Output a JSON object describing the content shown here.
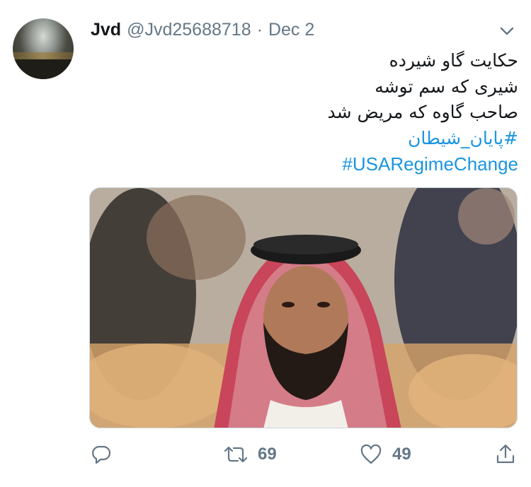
{
  "tweet": {
    "author_name": "Jvd",
    "author_handle": "@Jvd25688718",
    "separator": "·",
    "date": "Dec 2",
    "lines": [
      "حکایت گاو شیرده",
      "شیری که سم توشه",
      "صاحب گاوه که مریض شد"
    ],
    "hashtags": [
      "#پایان_شیطان",
      "#USARegimeChange"
    ]
  },
  "actions": {
    "reply_count": "",
    "retweet_count": "69",
    "like_count": "49"
  },
  "icons": {
    "menu": "chevron-down-icon",
    "reply": "reply-icon",
    "retweet": "retweet-icon",
    "like": "heart-icon",
    "share": "share-icon"
  },
  "colors": {
    "link": "#1b95e0",
    "secondary_text": "#657786",
    "primary_text": "#14171a"
  }
}
